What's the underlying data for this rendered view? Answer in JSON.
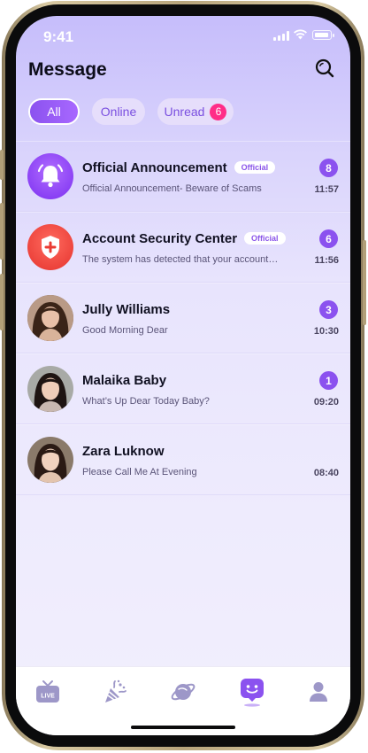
{
  "status": {
    "time": "9:41"
  },
  "header": {
    "title": "Message",
    "search_icon": "search-icon"
  },
  "tabs": {
    "all": "All",
    "online": "Online",
    "unread": "Unread",
    "unread_count": "6"
  },
  "messages": [
    {
      "name": "Official Announcement",
      "badge": "Official",
      "preview": "Official Announcement- Beware of Scams",
      "count": "8",
      "time": "11:57",
      "avatar": "bell-alert-icon"
    },
    {
      "name": "Account Security Center",
      "badge": "Official",
      "preview": "The system has detected that your account…",
      "count": "6",
      "time": "11:56",
      "avatar": "shield-plus-icon"
    },
    {
      "name": "Jully Williams",
      "preview": "Good Morning Dear",
      "count": "3",
      "time": "10:30",
      "avatar": "user-photo"
    },
    {
      "name": "Malaika Baby",
      "preview": "What’s Up Dear Today Baby?",
      "count": "1",
      "time": "09:20",
      "avatar": "user-photo"
    },
    {
      "name": "Zara Luknow",
      "preview": "Please Call Me At Evening",
      "time": "08:40",
      "avatar": "user-photo"
    }
  ],
  "bottom_nav": {
    "live_label": "LIVE",
    "items": [
      "live-tv-icon",
      "party-popper-icon",
      "planet-icon",
      "message-smile-icon",
      "profile-icon"
    ]
  },
  "colors": {
    "accent": "#8b52ef",
    "badge_pink": "#ff2d87",
    "security_red": "#f0463c"
  }
}
